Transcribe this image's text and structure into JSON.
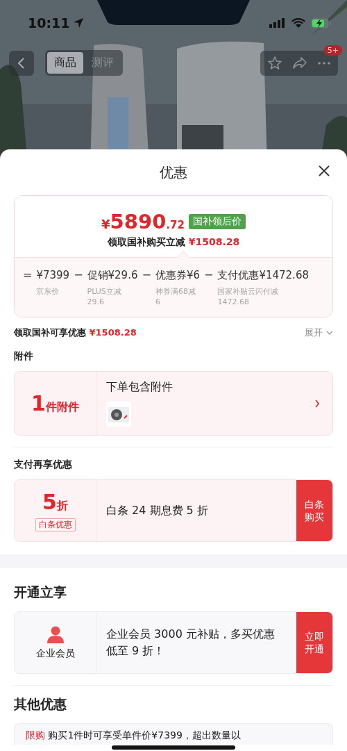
{
  "status_bar": {
    "time": "10:11"
  },
  "nav": {
    "tabs": [
      {
        "label": "商品",
        "selected": true
      },
      {
        "label": "测评",
        "selected": false
      }
    ],
    "badge": "5+"
  },
  "sheet": {
    "title": "优惠"
  },
  "price_card": {
    "currency": "¥",
    "price_integer": "5890",
    "price_decimal": ".72",
    "tag": "国补领后价",
    "saving_label": "领取国补购买立减",
    "saving_amount": "¥1508.28",
    "breakdown": [
      {
        "operator": "=",
        "amount": "¥7399",
        "note_lines": [
          "京东价"
        ]
      },
      {
        "operator": "−",
        "amount": "促销¥29.6",
        "note_lines": [
          "PLUS立减",
          "29.6"
        ]
      },
      {
        "operator": "−",
        "amount": "优惠券¥6",
        "note_lines": [
          "神券满68减",
          "6"
        ]
      },
      {
        "operator": "−",
        "amount": "支付优惠¥1472.68",
        "note_lines": [
          "国家补贴云闪付减",
          "1472.68"
        ]
      }
    ]
  },
  "subsidy_summary": {
    "label": "领取国补可享优惠",
    "amount": "¥1508.28",
    "toggle": "展开",
    "expanded": false
  },
  "sections": [
    {
      "kind": "accessory",
      "title": "附件",
      "count": "1",
      "unit": "件附件",
      "heading": "下单包含附件"
    },
    {
      "kind": "payment",
      "title": "支付再享优惠",
      "value": "5",
      "unit": "折",
      "tag": "白条优惠",
      "text": "白条 24 期息费 5 折",
      "action": "白条购买"
    },
    {
      "kind": "membership",
      "title": "开通立享",
      "badge_label": "企业会员",
      "text": "企业会员 3000 元补贴，多买优惠低至 9 折！",
      "action": "立即开通"
    },
    {
      "kind": "other",
      "title": "其他优惠",
      "tag": "限购",
      "text": "购买1件时可享受单件价¥7399，超出数量以"
    }
  ]
}
